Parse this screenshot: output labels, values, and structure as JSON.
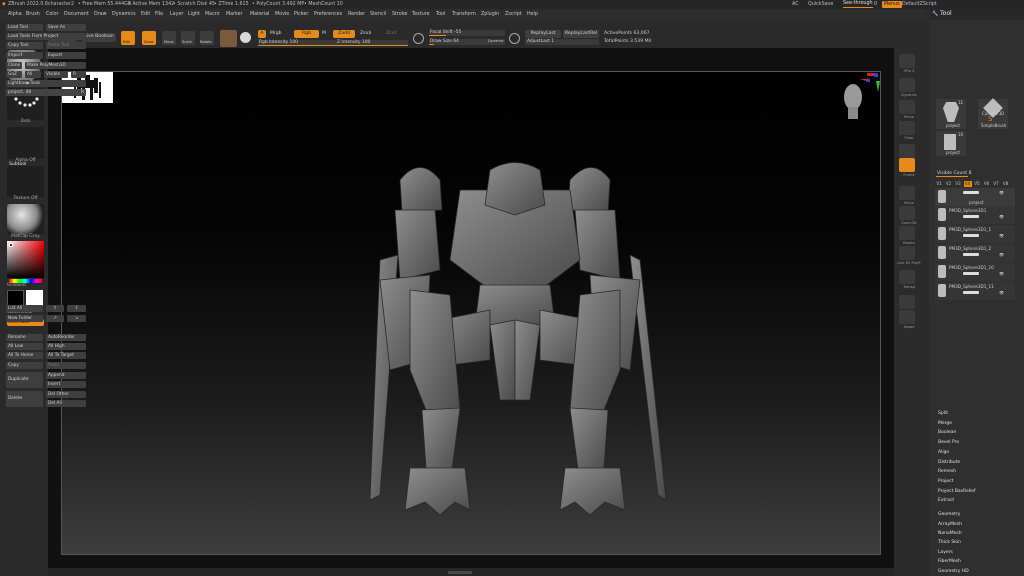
{
  "titlebar": {
    "app": "ZBrush 2022.0.6",
    "document": "character2",
    "free_mem": "• Free Mem 55.444GB",
    "active_mem": "• Active Mem 1342",
    "scratch": "• Scratch Disk 45",
    "ztime": "• ZTime 1.615",
    "polycount": "• PolyCount 3.492 MP",
    "meshcount": "• MeshCount 10",
    "ac": "AC",
    "quicksave": "QuickSave",
    "seethrough": "See-through",
    "seethrough_value": "0",
    "menus": "Menus",
    "default_script": "DefaultZScript"
  },
  "menubar": [
    "Alpha",
    "Brush",
    "Color",
    "Document",
    "Draw",
    "Dynamics",
    "Edit",
    "File",
    "Layer",
    "Light",
    "Macro",
    "Marker",
    "Material",
    "Movie",
    "Picker",
    "Preferences",
    "Render",
    "Stencil",
    "Stroke",
    "Texture",
    "Tool",
    "Transform",
    "Zplugin",
    "Zscript",
    "Help"
  ],
  "toolbar": {
    "home_page": "Home Page",
    "lightbox": "LightBox",
    "live_boolean": "Live Boolean",
    "edit": "Edit",
    "draw": "Draw",
    "move": "Move",
    "scale": "Scale",
    "rotate": "Rotate",
    "a": "A",
    "mrgb": "Mrgb",
    "rgb": "Rgb",
    "m": "M",
    "zadd": "Zadd",
    "zsub": "Zsub",
    "zcut": "Zcut",
    "rgb_intensity": "Rgb Intensity 100",
    "z_intensity": "Z Intensity 100",
    "focal_shift": "Focal Shift -55",
    "draw_size": "Draw Size 64",
    "dynamic": "Dynamic",
    "replay_last": "ReplayLast",
    "replay_last_rel": "ReplayLastRel",
    "adjust_last": "AdjustLast 1",
    "active_points": "ActivePoints 63,067",
    "total_points": "TotalPoints 3.539 Mil",
    "rgb_intensity_pct": 100,
    "z_intensity_pct": 100,
    "focal_shift_pct": 22,
    "draw_size_pct": 6
  },
  "leftpanel": {
    "brush": "Smooth",
    "stroke": "Dots",
    "alpha": "Alpha Off",
    "texture": "Texture Off",
    "material": "MatCap Gray",
    "gradient": "Gradient",
    "switch_color": "SwitchColor",
    "alternate": "Alternate"
  },
  "rightstrip": [
    {
      "label": "SPix 3",
      "orange": false
    },
    {
      "label": "Dynamic",
      "orange": false
    },
    {
      "label": "Persp",
      "orange": false
    },
    {
      "label": "Floor",
      "orange": false
    },
    {
      "label": "L.Sym",
      "orange": false
    },
    {
      "label": "Frame",
      "orange": true
    },
    {
      "label": "Move",
      "orange": false
    },
    {
      "label": "Zoom3D",
      "orange": false
    },
    {
      "label": "Rotate",
      "orange": false
    },
    {
      "label": "Line Fill PolyF",
      "orange": false
    },
    {
      "label": "Transp",
      "orange": false
    },
    {
      "label": "Solo",
      "orange": false
    },
    {
      "label": "Xpose",
      "orange": false
    }
  ],
  "toolpanel": {
    "title": "Tool",
    "load_tool": "Load Tool",
    "save_as": "Save As",
    "load_tools_from_project": "Load Tools From Project",
    "copy_tool": "Copy Tool",
    "paste_tool": "Paste Tool",
    "import": "Import",
    "export": "Export",
    "clone": "Clone",
    "make_polymesh3d": "Make PolyMesh3D",
    "goz": "GoZ",
    "all": "All",
    "visible": "Visible",
    "r": "R",
    "lightbox_tools": "Lightbox▶Tools",
    "project_slider": "project. 48",
    "project_slider_value": "R",
    "thumb_project": "project",
    "thumb_project_count": "11",
    "thumb_cylinder": "Cylinder3D",
    "thumb_simplebrush": "SimpleBrush",
    "thumb_project2": "project",
    "thumb_project2_count": "10",
    "subtool": "Subtool",
    "visible_count": "Visible Count 8",
    "v_buttons": [
      "V1",
      "V2",
      "V3",
      "V4",
      "V5",
      "V6",
      "V7",
      "V8"
    ],
    "subtools": [
      "project",
      "PM3D_Sphere3D1",
      "PM3D_Sphere3D1_1",
      "PM3D_Sphere3D1_2",
      "PM3D_Sphere3D1_10",
      "PM3D_Sphere3D1_11"
    ],
    "list_all": "List All",
    "new_folder": "New Folder",
    "rename": "Rename",
    "auto_reorder": "AutoReorder",
    "all_low": "All Low",
    "all_high": "All High",
    "all_to_home": "All To Home",
    "all_to_target": "All To Target",
    "copy": "Copy",
    "paste": "Paste",
    "duplicate": "Duplicate",
    "append": "Append",
    "insert": "Insert",
    "delete": "Delete",
    "del_other": "Del Other",
    "del_all": "Del All",
    "menu_items": [
      "Split",
      "Merge",
      "Boolean",
      "Bevel Pro",
      "Align",
      "Distribute",
      "Remesh",
      "Project",
      "Project BasRelief",
      "Extract"
    ],
    "bottom_items": [
      "Geometry",
      "ArrayMesh",
      "NanoMesh",
      "Thick Skin",
      "Layers",
      "FiberMesh",
      "Geometry HD"
    ]
  },
  "colors": {
    "accent": "#e68a19",
    "panel": "#2f2f2f",
    "button": "#3f3f3f"
  }
}
